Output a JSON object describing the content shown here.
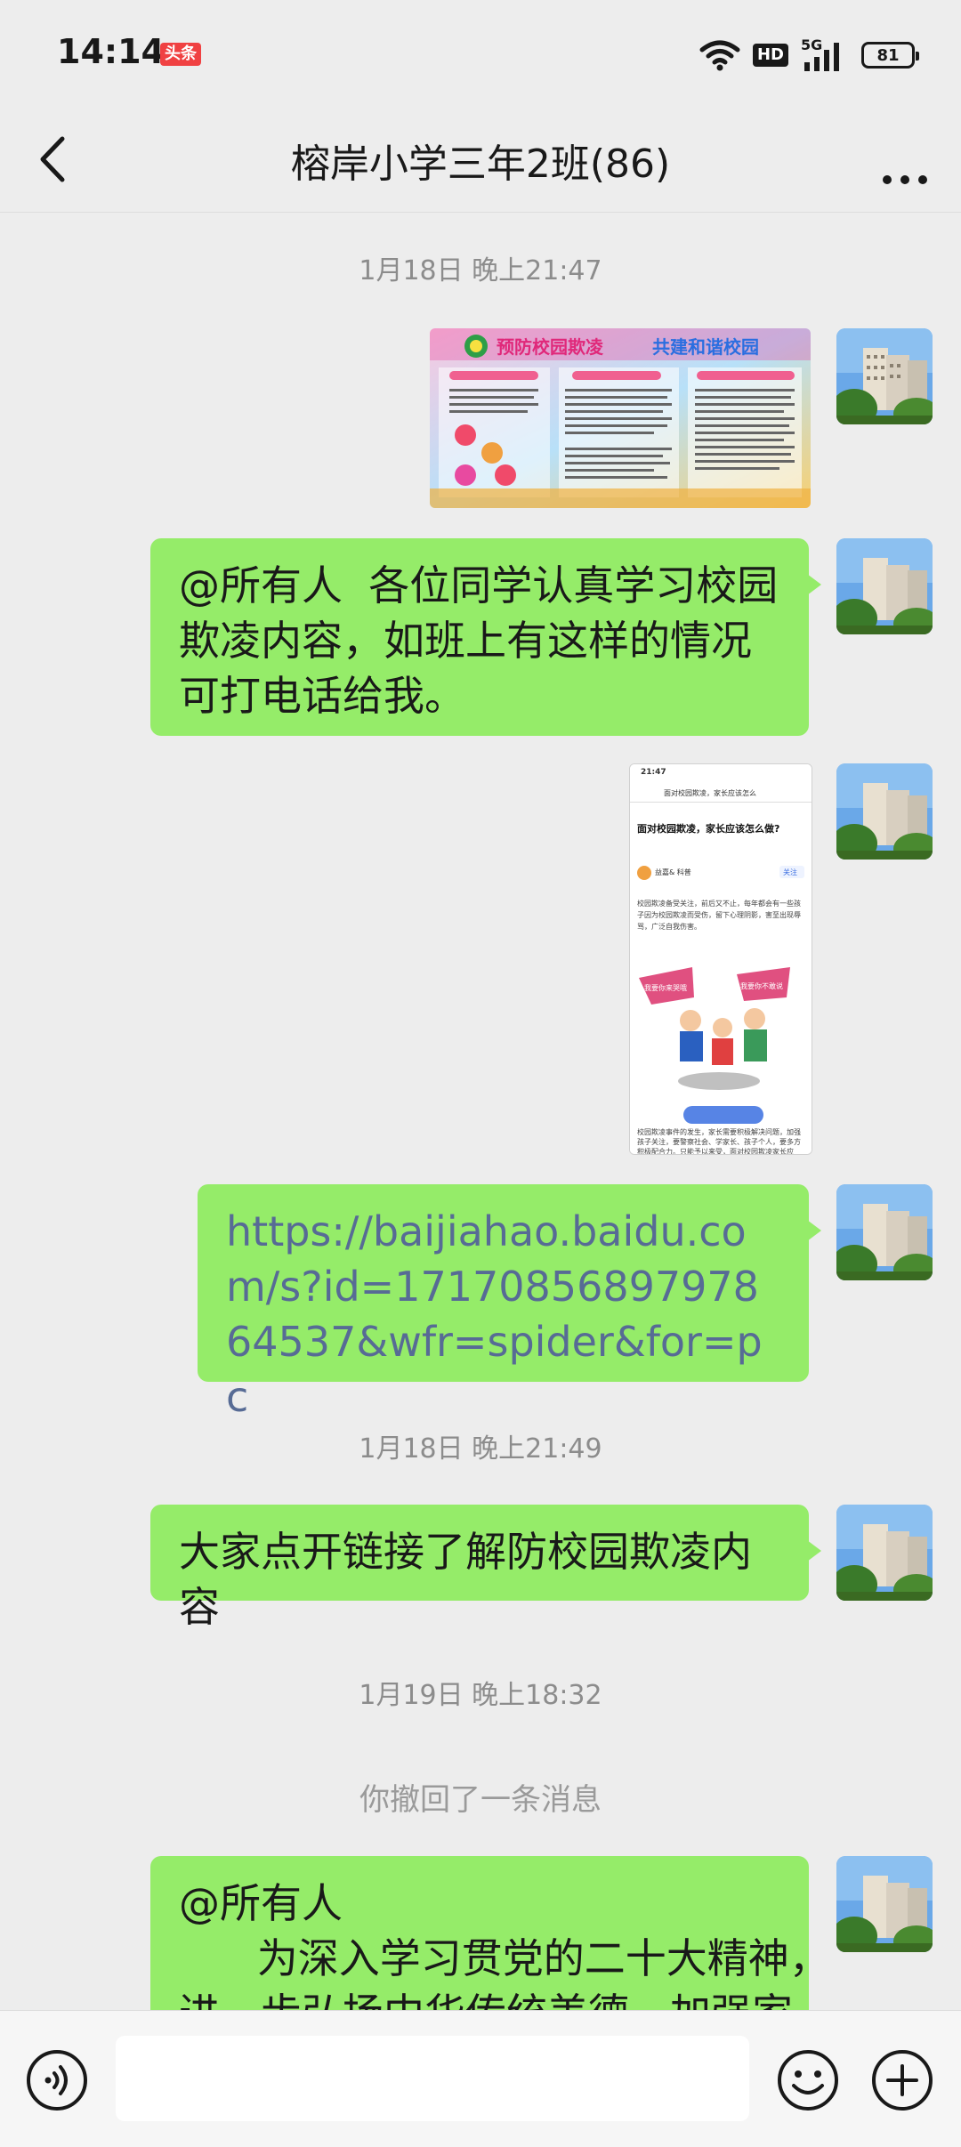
{
  "status_bar": {
    "time": "14:14",
    "app_badge": "头条",
    "hd_label": "HD",
    "network_label": "5G",
    "battery": "81"
  },
  "nav": {
    "title": "榕岸小学三年2班(86)",
    "back_icon": "chevron-left-icon",
    "more_icon": "more-dots-icon"
  },
  "messages": {
    "ts1": "1月18日 晚上21:47",
    "poster": {
      "title_left": "预防校园欺凌",
      "title_right": "共建和谐校园"
    },
    "msg_text1": "@所有人  各位同学认真学习校园欺凌内容，如班上有这样的情况可打电话给我。",
    "screenshot": {
      "time": "21:47",
      "header": "面对校园欺凌，家长应该怎么",
      "title": "面对校园欺凌，家长应该怎么做?",
      "author": "益嘉& 科普",
      "follow": "关注",
      "body": "校园欺凌备受关注，前后又不止，每年都会有一些孩子因为校园欺凌而受伤，留下心理阴影，害至出现辱骂，广泛自我伤害。",
      "speech_left": "我要你来哭哦",
      "speech_right": "我要你不敢说",
      "footer": "校园欺凌事件的发生，家长需要积极解决问题，加强孩子关注，要警察社会、学家长、孩子个人，要多方积极配合力。只能予以来受，面对校园欺凌家长应"
    },
    "msg_link": "https://baijiahao.baidu.com/s?id=1717085689797864537&wfr=spider&for=pc",
    "ts2": "1月18日 晚上21:49",
    "msg_text2": "大家点开链接了解防校园欺凌内容",
    "ts3": "1月19日 晚上18:32",
    "revoked": "你撤回了一条消息",
    "msg_text3_line1": "@所有人",
    "msg_text3_line2": "      为深入学习贯党的二十大精神，",
    "msg_text3_line3": "进一步弘扬中华传统美德，加强家"
  },
  "input_bar": {
    "placeholder": "",
    "voice_icon": "voice-icon",
    "emoji_icon": "emoji-icon",
    "plus_icon": "plus-icon"
  },
  "colors": {
    "background": "#ededed",
    "bubble_green": "#95ec69",
    "link_blue": "#576b95",
    "timestamp_gray": "#8c8c8c"
  }
}
